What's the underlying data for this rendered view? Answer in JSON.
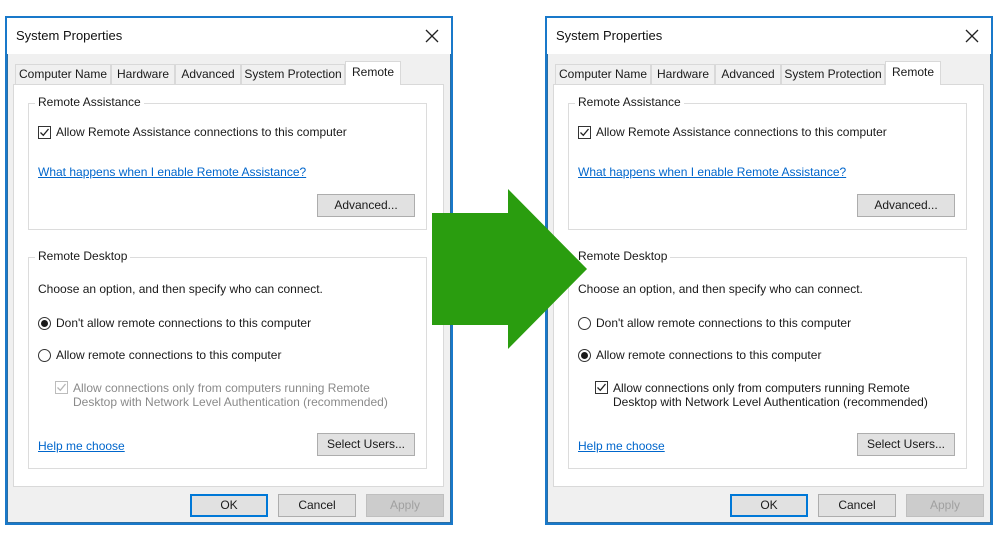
{
  "colors": {
    "dialog_border": "#1979ca",
    "dialog_bg": "#f0f0f0",
    "link": "#0066cc",
    "arrow": "#2a9d0f",
    "default_button_border": "#0078d7"
  },
  "dialogs": [
    {
      "state": "before",
      "title": "System Properties",
      "close_icon": "close-icon",
      "tabs": [
        {
          "label": "Computer Name",
          "active": false
        },
        {
          "label": "Hardware",
          "active": false
        },
        {
          "label": "Advanced",
          "active": false
        },
        {
          "label": "System Protection",
          "active": false
        },
        {
          "label": "Remote",
          "active": true
        }
      ],
      "remote_assistance": {
        "group_label": "Remote Assistance",
        "allow_checkbox": {
          "label": "Allow Remote Assistance connections to this computer",
          "checked": true
        },
        "help_link": "What happens when I enable Remote Assistance?",
        "advanced_button": "Advanced..."
      },
      "remote_desktop": {
        "group_label": "Remote Desktop",
        "instruction": "Choose an option, and then specify who can connect.",
        "options": [
          {
            "label": "Don't allow remote connections to this computer",
            "selected": true
          },
          {
            "label": "Allow remote connections to this computer",
            "selected": false
          }
        ],
        "nla_checkbox": {
          "line1": "Allow connections only from computers running Remote",
          "line2": "Desktop with Network Level Authentication (recommended)",
          "checked": true,
          "enabled": false
        },
        "help_link": "Help me choose",
        "select_users_button": "Select Users..."
      },
      "buttons": {
        "ok": "OK",
        "cancel": "Cancel",
        "apply": "Apply",
        "apply_enabled": false
      }
    },
    {
      "state": "after",
      "title": "System Properties",
      "close_icon": "close-icon",
      "tabs": [
        {
          "label": "Computer Name",
          "active": false
        },
        {
          "label": "Hardware",
          "active": false
        },
        {
          "label": "Advanced",
          "active": false
        },
        {
          "label": "System Protection",
          "active": false
        },
        {
          "label": "Remote",
          "active": true
        }
      ],
      "remote_assistance": {
        "group_label": "Remote Assistance",
        "allow_checkbox": {
          "label": "Allow Remote Assistance connections to this computer",
          "checked": true
        },
        "help_link": "What happens when I enable Remote Assistance?",
        "advanced_button": "Advanced..."
      },
      "remote_desktop": {
        "group_label": "Remote Desktop",
        "instruction": "Choose an option, and then specify who can connect.",
        "options": [
          {
            "label": "Don't allow remote connections to this computer",
            "selected": false
          },
          {
            "label": "Allow remote connections to this computer",
            "selected": true
          }
        ],
        "nla_checkbox": {
          "line1": "Allow connections only from computers running Remote",
          "line2": "Desktop with Network Level Authentication (recommended)",
          "checked": true,
          "enabled": true
        },
        "help_link": "Help me choose",
        "select_users_button": "Select Users..."
      },
      "buttons": {
        "ok": "OK",
        "cancel": "Cancel",
        "apply": "Apply",
        "apply_enabled": false
      }
    }
  ],
  "transition_arrow": {
    "icon": "right-arrow-icon",
    "direction": "right"
  }
}
